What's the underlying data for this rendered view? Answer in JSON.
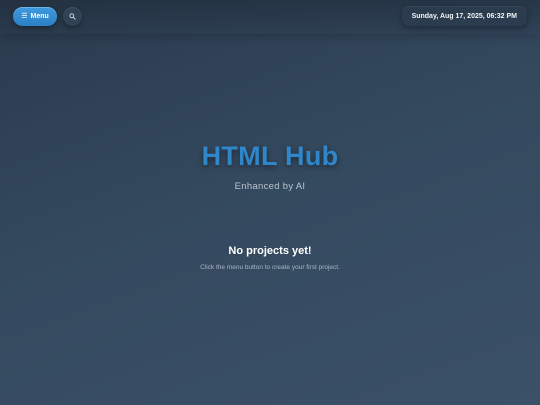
{
  "header": {
    "menu_icon": "☰",
    "menu_label": "Menu",
    "search_icon": "search-icon",
    "datetime": "Sunday, Aug 17, 2025, 06:32 PM"
  },
  "hero": {
    "title": "HTML Hub",
    "subtitle": "Enhanced by AI"
  },
  "empty_state": {
    "title": "No projects yet!",
    "hint": "Click the menu button to create your first project."
  },
  "colors": {
    "accent": "#2f86c9",
    "button": "#3a93d8",
    "background": "#34495e"
  }
}
